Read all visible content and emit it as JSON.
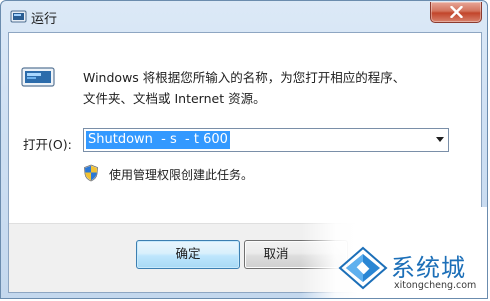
{
  "window": {
    "title": "运行",
    "close_label": "Close"
  },
  "dialog": {
    "description_line1": "Windows 将根据您所输入的名称，为您打开相应的程序、",
    "description_line2": "文件夹、文档或 Internet 资源。",
    "open_label": "打开(O):",
    "command_value": "Shutdown  - s  - t 600",
    "admin_note": "使用管理权限创建此任务。"
  },
  "buttons": {
    "ok_label": "确定",
    "cancel_label": "取消"
  },
  "watermark": {
    "name": "系统城",
    "url": "xitongcheng.com"
  },
  "colors": {
    "selection": "#3399ff",
    "titlebar": "#cfe0f3",
    "close_button": "#c2452b",
    "watermark_blue": "#1c6fb8"
  }
}
